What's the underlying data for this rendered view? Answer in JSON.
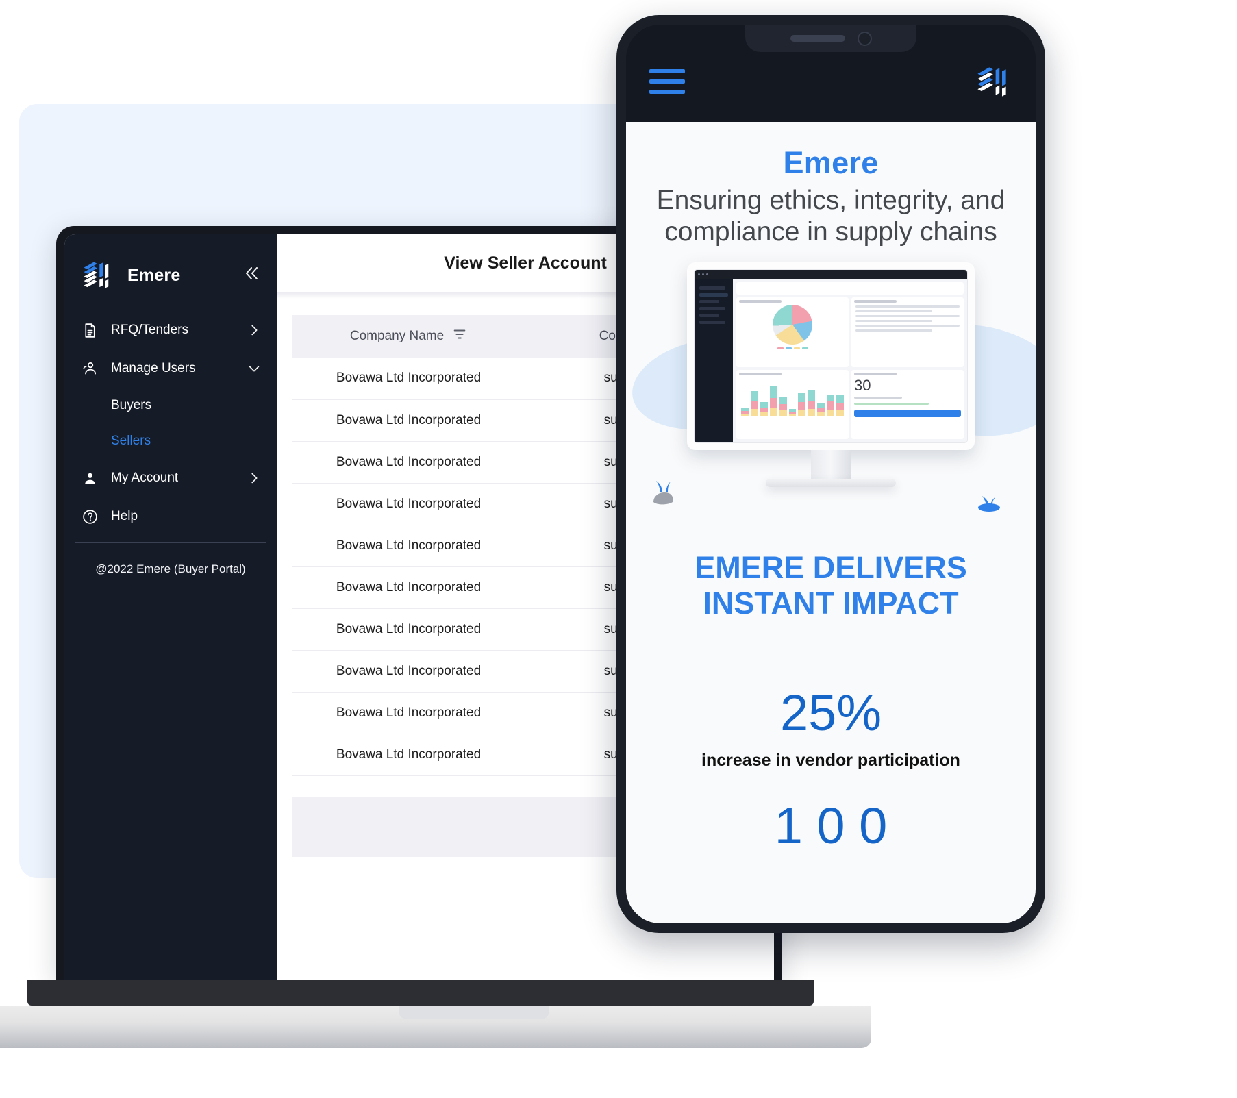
{
  "laptop": {
    "sidebar": {
      "brand": "Emere",
      "collapse_icon": "chevron-double-left-icon",
      "items": [
        {
          "label": "RFQ/Tenders",
          "icon": "document-icon",
          "chevron": "chevron-right-icon"
        },
        {
          "label": "Manage Users",
          "icon": "users-icon",
          "chevron": "chevron-down-icon"
        },
        {
          "label": "My Account",
          "icon": "user-icon",
          "chevron": "chevron-right-icon"
        },
        {
          "label": "Help",
          "icon": "question-circle-icon",
          "chevron": ""
        }
      ],
      "submenu": [
        {
          "label": "Buyers",
          "active": false
        },
        {
          "label": "Sellers",
          "active": true
        }
      ],
      "footer": "@2022 Emere (Buyer Portal)",
      "active_color": "#2f80e8"
    },
    "page": {
      "title": "View Seller Account",
      "table": {
        "columns": [
          {
            "label": "Company Name",
            "filter_icon": "filter-icon"
          },
          {
            "label": "Company Ema",
            "filter_icon": ""
          }
        ],
        "rows": [
          {
            "company_name": "Bovawa Ltd Incorporated",
            "company_email": "supplier.wan("
          },
          {
            "company_name": "Bovawa Ltd Incorporated",
            "company_email": "supplier.wan("
          },
          {
            "company_name": "Bovawa Ltd Incorporated",
            "company_email": "supplier.wan("
          },
          {
            "company_name": "Bovawa Ltd Incorporated",
            "company_email": "supplier.wan("
          },
          {
            "company_name": "Bovawa Ltd Incorporated",
            "company_email": "supplier.wan("
          },
          {
            "company_name": "Bovawa Ltd Incorporated",
            "company_email": "supplier.wan("
          },
          {
            "company_name": "Bovawa Ltd Incorporated",
            "company_email": "supplier.wan("
          },
          {
            "company_name": "Bovawa Ltd Incorporated",
            "company_email": "supplier.wan("
          },
          {
            "company_name": "Bovawa Ltd Incorporated",
            "company_email": "supplier.wan("
          },
          {
            "company_name": "Bovawa Ltd Incorporated",
            "company_email": "supplier.wan("
          }
        ]
      }
    }
  },
  "phone": {
    "topbar": {
      "menu_icon": "hamburger-menu-icon",
      "logo_icon": "emere-logo-icon"
    },
    "hero": {
      "brand": "Emere",
      "tagline": "Ensuring ethics, integrity, and compliance in supply chains"
    },
    "illustration": {
      "dashboard_stat": "30",
      "plant_left_icon": "plant-rock-icon",
      "plant_right_icon": "plant-icon"
    },
    "impact": {
      "line1": "EMERE DELIVERS",
      "line2": "INSTANT IMPACT"
    },
    "stats": [
      {
        "value": "25%",
        "caption": "increase in vendor participation"
      },
      {
        "value": "1 0 0",
        "caption": ""
      }
    ]
  },
  "colors": {
    "accent": "#2f80e8",
    "stat_blue": "#1565c9",
    "sidebar_bg": "#161c27",
    "backdrop": "#eef4fd"
  }
}
